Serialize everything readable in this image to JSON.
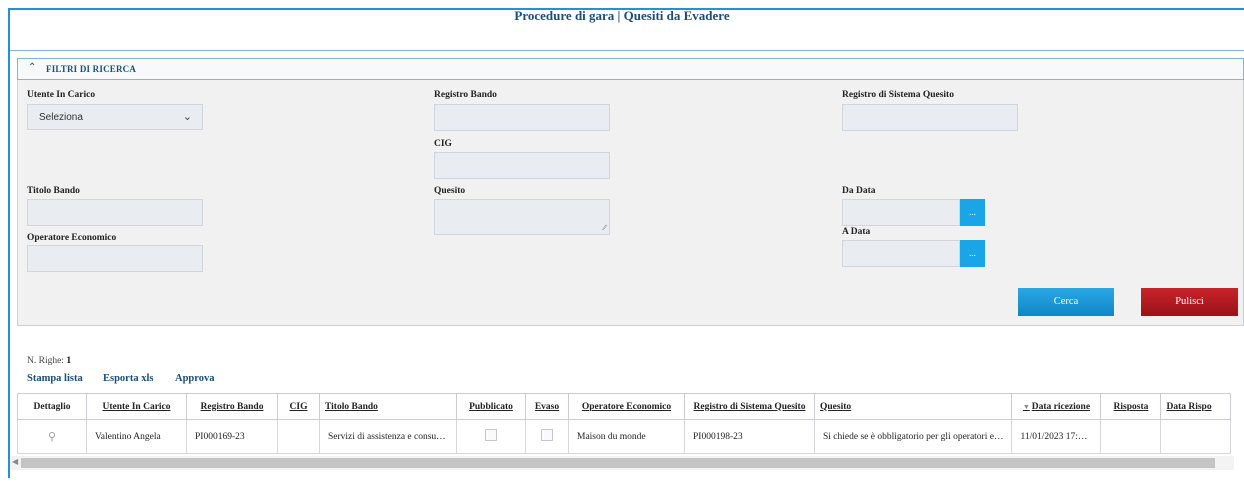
{
  "page": {
    "title": "Procedure di gara | Quesiti da Evadere"
  },
  "filters": {
    "header": "FILTRI DI RICERCA",
    "utente_in_carico": {
      "label": "Utente In Carico",
      "value": "Seleziona"
    },
    "registro_bando": {
      "label": "Registro Bando",
      "value": ""
    },
    "registro_sistema_quesito": {
      "label": "Registro di Sistema Quesito",
      "value": ""
    },
    "cig": {
      "label": "CIG",
      "value": ""
    },
    "titolo_bando": {
      "label": "Titolo Bando",
      "value": ""
    },
    "quesito": {
      "label": "Quesito",
      "value": ""
    },
    "da_data": {
      "label": "Da Data",
      "value": "",
      "button": "..."
    },
    "a_data": {
      "label": "A Data",
      "value": "",
      "button": "..."
    },
    "operatore_economico": {
      "label": "Operatore Economico",
      "value": ""
    },
    "cerca_label": "Cerca",
    "pulisci_label": "Pulisci"
  },
  "results": {
    "count_label": "N. Righe:",
    "count": "1",
    "actions": [
      "Stampa lista",
      "Esporta xls",
      "Approva"
    ],
    "columns": [
      "Dettaglio",
      "Utente In Carico",
      "Registro Bando",
      "CIG",
      "Titolo Bando",
      "Pubblicato",
      "Evaso",
      "Operatore Economico",
      "Registro di Sistema Quesito",
      "Quesito",
      "Data ricezione",
      "Risposta",
      "Data Rispo"
    ],
    "rows": [
      {
        "utente": "Valentino Angela",
        "registro_bando": "PI000169-23",
        "cig": "",
        "titolo_bando": "Servizi di assistenza e consu…",
        "pubblicato": false,
        "evaso": false,
        "operatore": "Maison du monde",
        "registro_sistema": "PI000198-23",
        "quesito": "Si chiede se è obbligatorio per gli operatori e…",
        "data_ricezione": "11/01/2023 17:…",
        "risposta": "",
        "data_risposta": ""
      }
    ]
  },
  "colors": {
    "accent": "#1a4d7a",
    "primary_button": "#1aa6e6",
    "danger_button": "#b81b22"
  }
}
